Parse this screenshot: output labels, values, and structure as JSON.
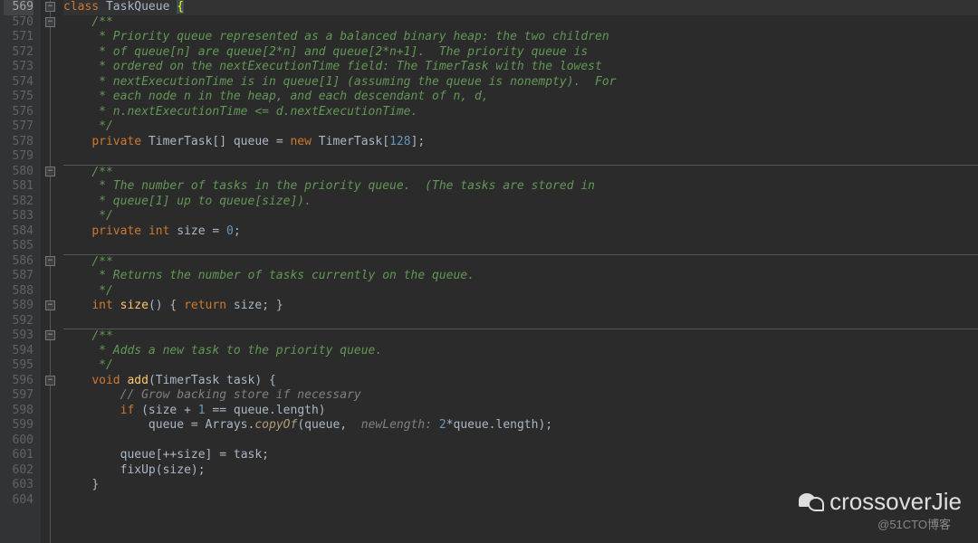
{
  "line_numbers": [
    "569",
    "570",
    "571",
    "572",
    "573",
    "574",
    "575",
    "576",
    "577",
    "578",
    "579",
    "580",
    "581",
    "582",
    "583",
    "584",
    "585",
    "586",
    "587",
    "588",
    "589",
    "592",
    "593",
    "594",
    "595",
    "596",
    "597",
    "598",
    "599",
    "600",
    "601",
    "602",
    "603",
    "604"
  ],
  "highlighted_line": "569",
  "code": {
    "l569": {
      "kw1": "class",
      "cls": "TaskQueue",
      "br": "{"
    },
    "l570": {
      "c": "/**"
    },
    "l571": {
      "c": " * Priority queue represented as a balanced binary heap: the two children"
    },
    "l572": {
      "c": " * of queue[n] are queue[2*n] and queue[2*n+1].  The priority queue is"
    },
    "l573": {
      "c": " * ordered on the nextExecutionTime field: The TimerTask with the lowest"
    },
    "l574": {
      "c": " * nextExecutionTime is in queue[1] (assuming the queue is nonempty).  For"
    },
    "l575": {
      "c": " * each node n in the heap, and each descendant of n, d,"
    },
    "l576": {
      "c": " * n.nextExecutionTime <= d.nextExecutionTime."
    },
    "l577": {
      "c": " */"
    },
    "l578": {
      "kw1": "private",
      "type": "TimerTask[]",
      "name": "queue",
      "eq": "=",
      "kw2": "new",
      "type2": "TimerTask",
      "br": "[",
      "num": "128",
      "end": "];"
    },
    "l580": {
      "c": "/**"
    },
    "l581": {
      "c": " * The number of tasks in the priority queue.  (The tasks are stored in"
    },
    "l582": {
      "c": " * queue[1] up to queue[size])."
    },
    "l583": {
      "c": " */"
    },
    "l584": {
      "kw1": "private",
      "kw2": "int",
      "name": "size",
      "eq": "=",
      "num": "0",
      "end": ";"
    },
    "l586": {
      "c": "/**"
    },
    "l587": {
      "c": " * Returns the number of tasks currently on the queue."
    },
    "l588": {
      "c": " */"
    },
    "l589": {
      "kw1": "int",
      "fn": "size",
      "p": "() {",
      "kw2": "return",
      "name": "size",
      "end": "; }"
    },
    "l593": {
      "c": "/**"
    },
    "l594": {
      "c": " * Adds a new task to the priority queue."
    },
    "l595": {
      "c": " */"
    },
    "l596": {
      "kw1": "void",
      "fn": "add",
      "p1": "(",
      "type": "TimerTask",
      "param": "task",
      "p2": ") {"
    },
    "l597": {
      "c": "// Grow backing store if necessary"
    },
    "l598": {
      "kw1": "if",
      "p1": "(size",
      "op": "+",
      "n1": "1",
      "eq": "==",
      "rest": "queue.length)"
    },
    "l599": {
      "v": "queue",
      "eq": "=",
      "cls": "Arrays",
      "dot": ".",
      "fn": "copyOf",
      "p1": "(queue,",
      "hint": "newLength:",
      "n2": "2",
      "op": "*",
      "rest": "queue.length);"
    },
    "l601": {
      "v1": "queue[",
      "op": "++",
      "v2": "size]",
      "eq": "=",
      "v3": "task;"
    },
    "l602": {
      "fn": "fixUp",
      "rest": "(size);"
    },
    "l603": {
      "br": "}"
    }
  },
  "watermark": {
    "text": "crossoverJie",
    "sub": "@51CTO博客"
  }
}
